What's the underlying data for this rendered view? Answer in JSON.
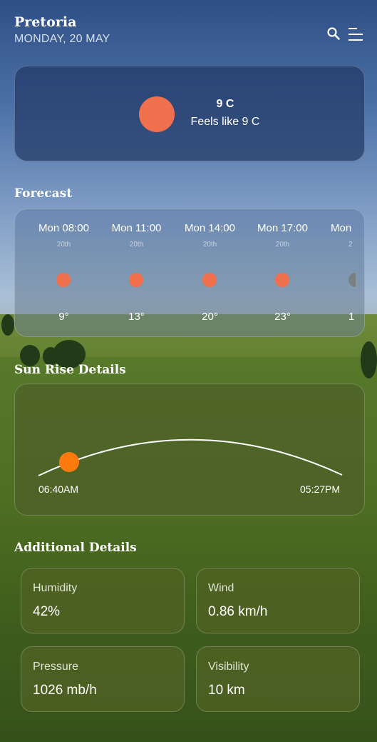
{
  "header": {
    "city": "Pretoria",
    "date": "MONDAY, 20 MAY"
  },
  "current": {
    "temp": "9 C",
    "feels_like": "Feels like 9 C",
    "icon": "sun-icon"
  },
  "forecast": {
    "title": "Forecast",
    "items": [
      {
        "time": "Mon 08:00",
        "day": "20th",
        "temp": "9°"
      },
      {
        "time": "Mon 11:00",
        "day": "20th",
        "temp": "13°"
      },
      {
        "time": "Mon 14:00",
        "day": "20th",
        "temp": "20°"
      },
      {
        "time": "Mon 17:00",
        "day": "20th",
        "temp": "23°"
      },
      {
        "time": "Mon",
        "day": "2",
        "temp": "1"
      }
    ]
  },
  "sunrise": {
    "title": "Sun Rise Details",
    "sunrise": "06:40AM",
    "sunset": "05:27PM"
  },
  "additional": {
    "title": "Additional Details",
    "items": [
      {
        "label": "Humidity",
        "value": "42%"
      },
      {
        "label": "Wind",
        "value": "0.86 km/h"
      },
      {
        "label": "Pressure",
        "value": "1026 mb/h"
      },
      {
        "label": "Visibility",
        "value": "10 km"
      }
    ]
  },
  "colors": {
    "sun": "#f0704e",
    "sun_marker": "#ff7a0e"
  }
}
